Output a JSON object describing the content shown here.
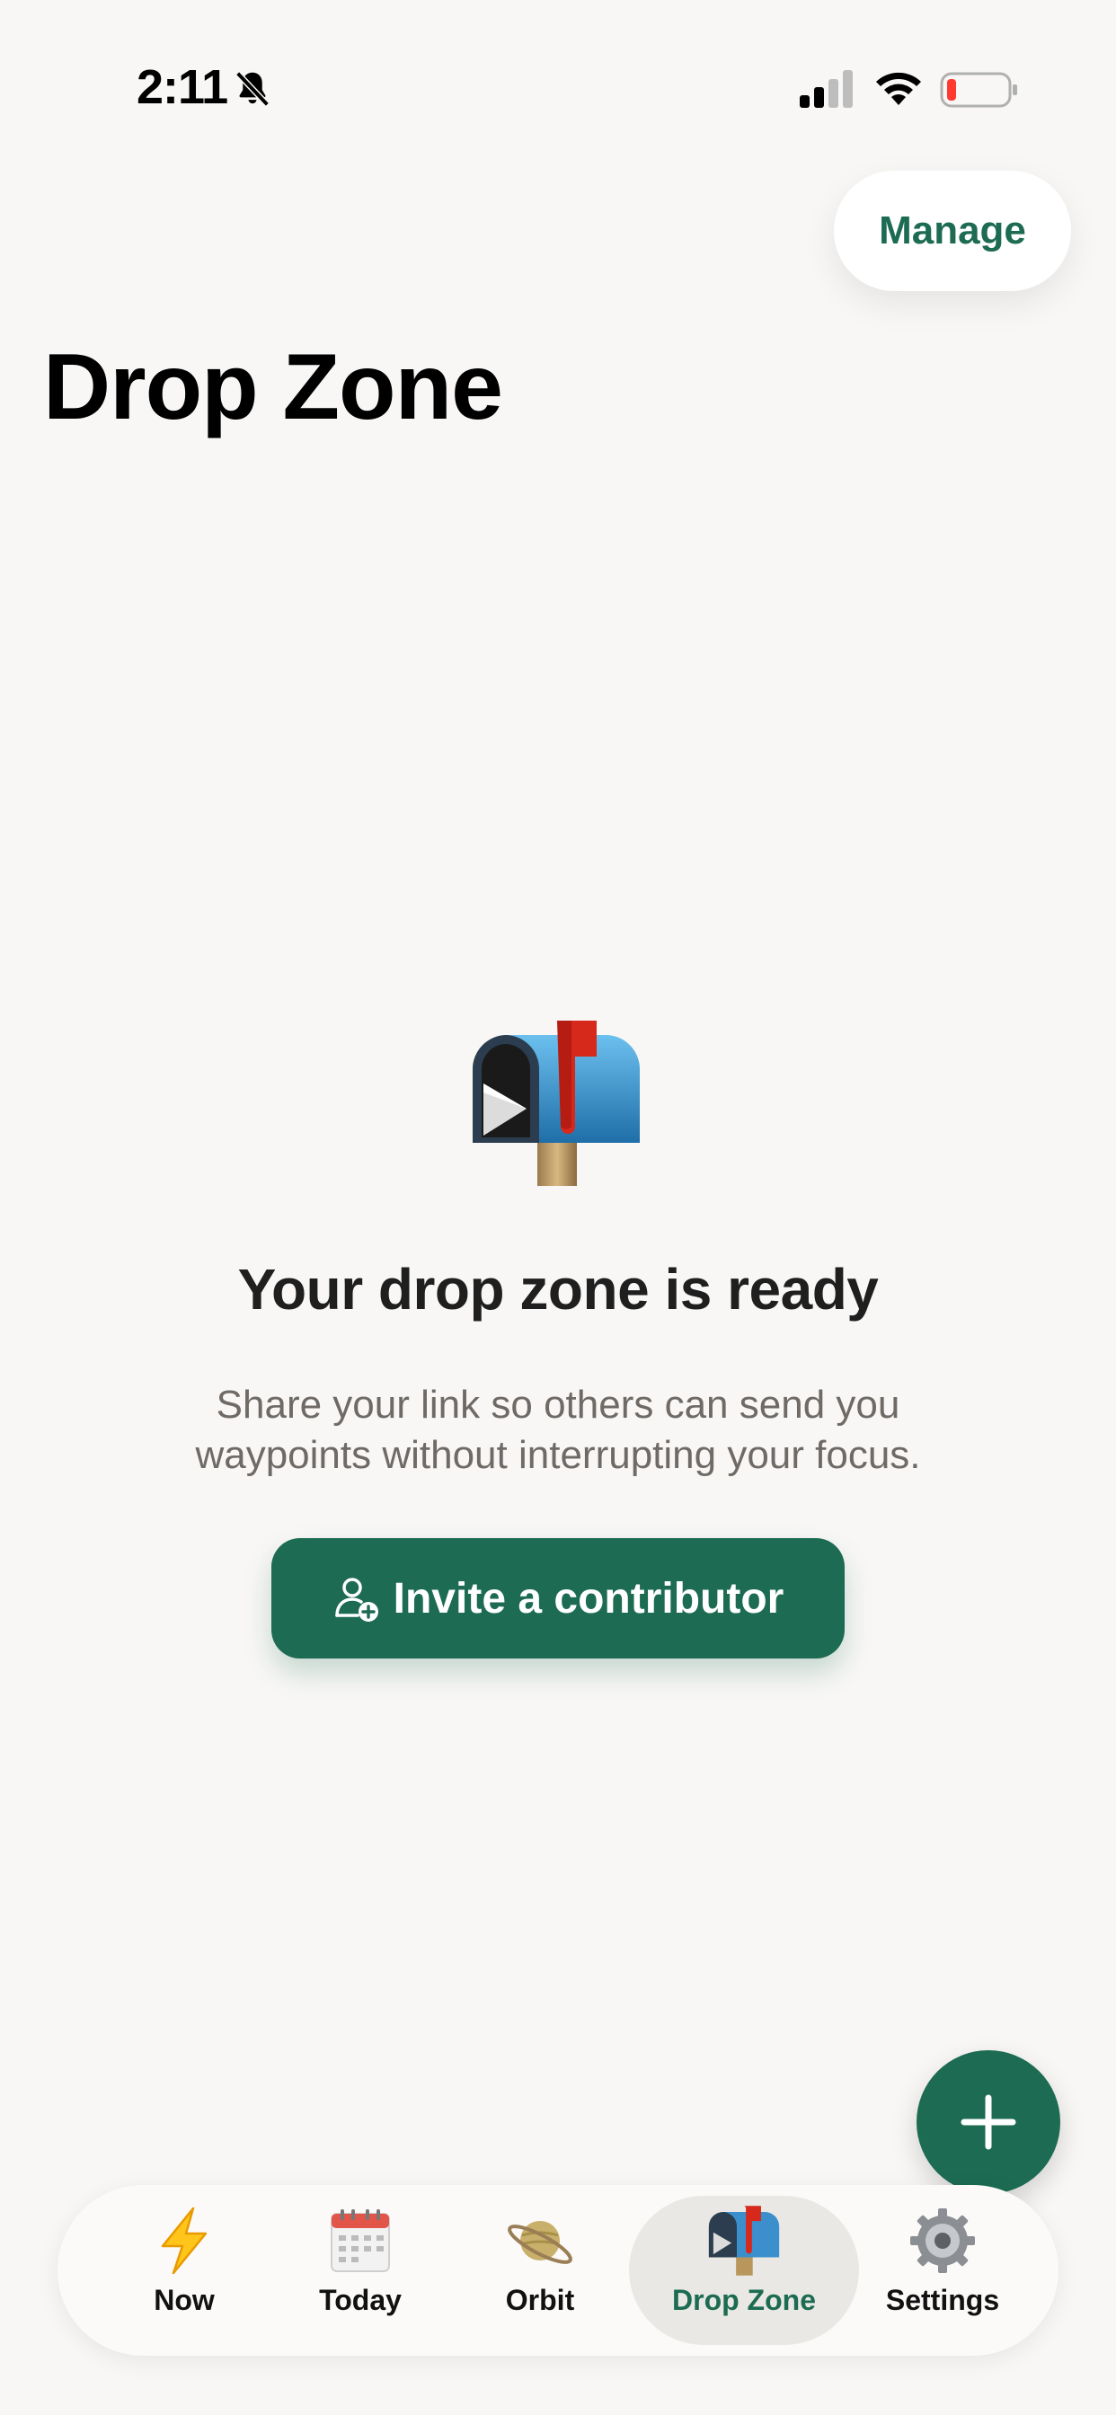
{
  "status_bar": {
    "time": "2:11",
    "battery_color": "#ff3b30"
  },
  "header": {
    "manage_label": "Manage",
    "title": "Drop Zone"
  },
  "empty_state": {
    "icon": "mailbox-icon",
    "title": "Your drop zone is ready",
    "line1": "Share your link so others can send you",
    "line2": "waypoints without interrupting your focus.",
    "button_label": "Invite a contributor",
    "button_icon": "add-person-icon"
  },
  "fab": {
    "icon": "plus-icon"
  },
  "tabs": [
    {
      "label": "Now",
      "icon": "lightning-icon",
      "active": false
    },
    {
      "label": "Today",
      "icon": "calendar-icon",
      "active": false
    },
    {
      "label": "Orbit",
      "icon": "planet-icon",
      "active": false
    },
    {
      "label": "Drop Zone",
      "icon": "mailbox-icon",
      "active": true
    },
    {
      "label": "Settings",
      "icon": "gear-icon",
      "active": false
    }
  ],
  "colors": {
    "accent": "#1c6b52",
    "background": "#f8f7f5",
    "secondary_text": "#6f6a66"
  }
}
